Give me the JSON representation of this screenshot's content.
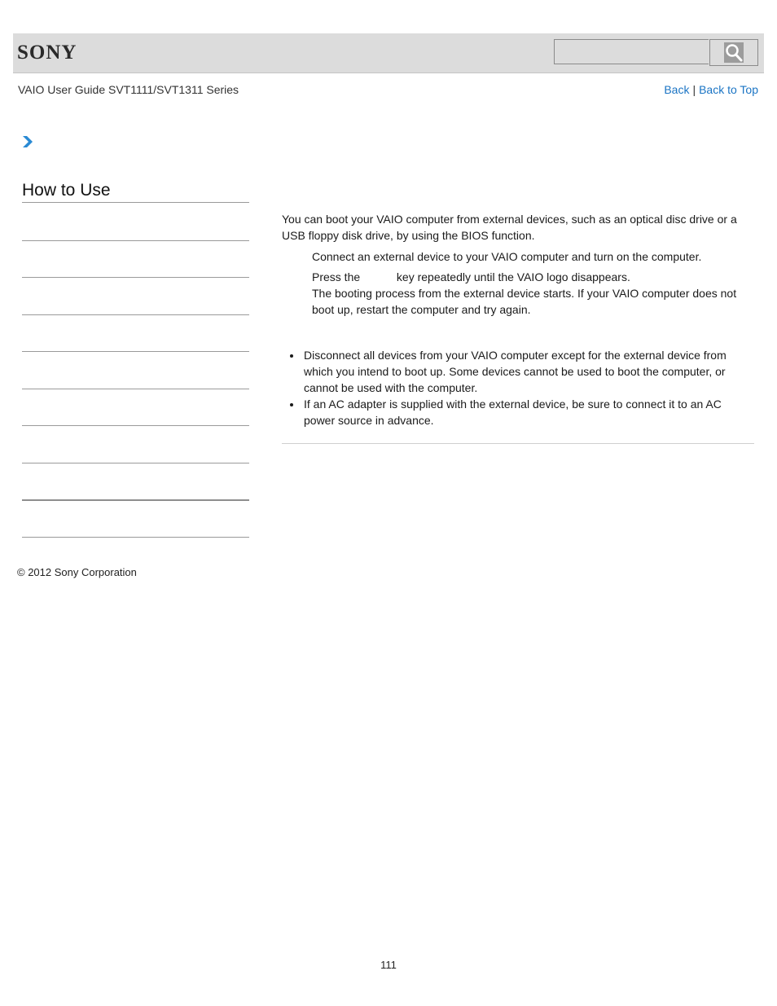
{
  "header": {
    "logo": "SONY",
    "search": {
      "placeholder": "",
      "value": ""
    },
    "search_icon": "magnifier-icon"
  },
  "subheader": {
    "guide_title": "VAIO User Guide SVT1111/SVT1311 Series",
    "back_label": "Back",
    "separator": "|",
    "back_to_top_label": "Back to Top"
  },
  "breadcrumb": {
    "icon": "chevron-right-icon",
    "color": "#2a8ad4"
  },
  "sidebar": {
    "title": "How to Use",
    "items": [
      {
        "label": ""
      },
      {
        "label": ""
      },
      {
        "label": ""
      },
      {
        "label": ""
      },
      {
        "label": ""
      },
      {
        "label": ""
      },
      {
        "label": ""
      },
      {
        "label": ""
      },
      {
        "label": ""
      }
    ]
  },
  "main": {
    "intro": "You can boot your VAIO computer from external devices, such as an optical disc drive or a USB floppy disk drive, by using the BIOS function.",
    "steps": [
      {
        "text": "Connect an external device to your VAIO computer and turn on the computer."
      },
      {
        "text_before_key": "Press the",
        "key": "",
        "text_after_key": "key repeatedly until the VAIO logo disappears.",
        "result": "The booting process from the external device starts. If your VAIO computer does not boot up, restart the computer and try again."
      }
    ],
    "notes": [
      "Disconnect all devices from your VAIO computer except for the external device from which you intend to boot up. Some devices cannot be used to boot the computer, or cannot be used with the computer.",
      "If an AC adapter is supplied with the external device, be sure to connect it to an AC power source in advance."
    ]
  },
  "footer": {
    "copyright": "© 2012 Sony Corporation",
    "page_number": "111"
  },
  "colors": {
    "link": "#1a74c4",
    "header_bg": "#dcdcdc",
    "accent": "#2a8ad4"
  }
}
